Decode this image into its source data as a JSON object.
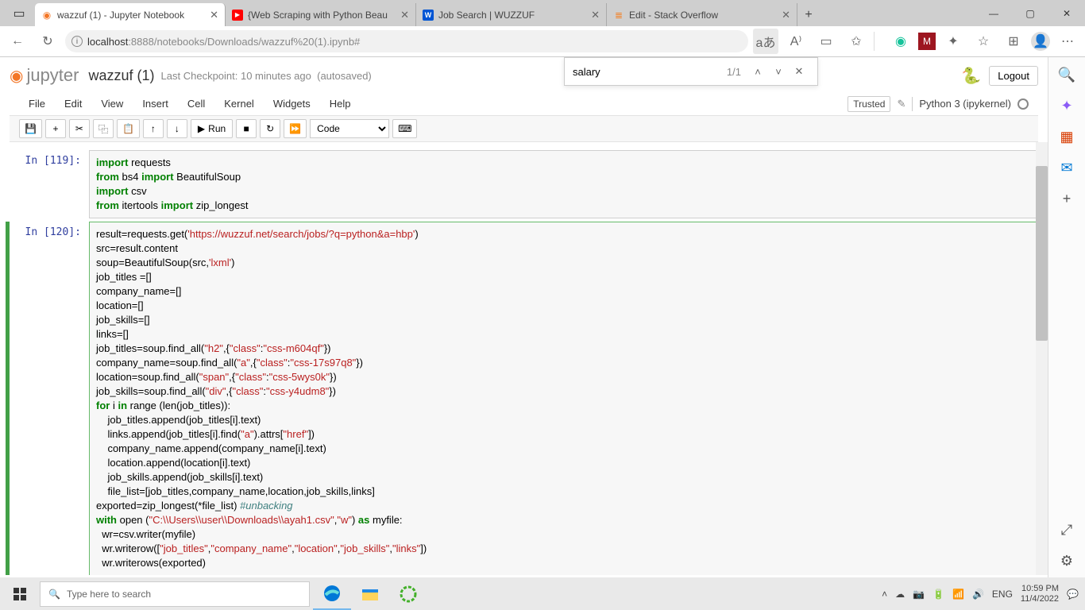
{
  "browser": {
    "tabs": [
      {
        "title": "wazzuf (1) - Jupyter Notebook",
        "active": true,
        "icon": "jupyter"
      },
      {
        "title": "{Web Scraping with Python Beau",
        "active": false,
        "icon": "youtube"
      },
      {
        "title": "Job Search | WUZZUF",
        "active": false,
        "icon": "wuzzuf"
      },
      {
        "title": "Edit - Stack Overflow",
        "active": false,
        "icon": "stackoverflow"
      }
    ],
    "url_host_prefix": "localhost",
    "url_path": ":8888/notebooks/Downloads/wazzuf%20(1).ipynb#"
  },
  "find": {
    "query": "salary",
    "count": "1/1"
  },
  "jupyter": {
    "logo_text": "jupyter",
    "title": "wazzuf (1)",
    "checkpoint": "Last Checkpoint: 10 minutes ago",
    "autosave": "(autosaved)",
    "logout": "Logout",
    "trusted": "Trusted",
    "kernel": "Python 3 (ipykernel)",
    "menus": [
      "File",
      "Edit",
      "View",
      "Insert",
      "Cell",
      "Kernel",
      "Widgets",
      "Help"
    ],
    "run_label": "Run",
    "cell_type": "Code"
  },
  "cells": {
    "c1_prompt": "In [119]:",
    "c2_prompt": "In [120]:",
    "c1_l1a": "import",
    "c1_l1b": " requests",
    "c1_l2a": "from",
    "c1_l2b": " bs4 ",
    "c1_l2c": "import",
    "c1_l2d": " BeautifulSoup",
    "c1_l3a": "import",
    "c1_l3b": " csv",
    "c1_l4a": "from",
    "c1_l4b": " itertools ",
    "c1_l4c": "import",
    "c1_l4d": " zip_longest",
    "c2_l1a": "result=requests.get(",
    "c2_l1b": "'https://wuzzuf.net/search/jobs/?q=python&a=hbp'",
    "c2_l1c": ")",
    "c2_l2": "src=result.content",
    "c2_l3a": "soup=BeautifulSoup(src,",
    "c2_l3b": "'lxml'",
    "c2_l3c": ")",
    "c2_l4": "job_titles =[]",
    "c2_l5": "company_name=[]",
    "c2_l6": "location=[]",
    "c2_l7": "job_skills=[]",
    "c2_l8": "links=[]",
    "c2_l9a": "job_titles=soup.find_all(",
    "c2_l9b": "\"h2\"",
    "c2_l9c": ",{",
    "c2_l9d": "\"class\"",
    "c2_l9e": ":",
    "c2_l9f": "\"css-m604qf\"",
    "c2_l9g": "})",
    "c2_l10a": "company_name=soup.find_all(",
    "c2_l10b": "\"a\"",
    "c2_l10c": ",{",
    "c2_l10d": "\"class\"",
    "c2_l10e": ":",
    "c2_l10f": "\"css-17s97q8\"",
    "c2_l10g": "})",
    "c2_l11a": "location=soup.find_all(",
    "c2_l11b": "\"span\"",
    "c2_l11c": ",{",
    "c2_l11d": "\"class\"",
    "c2_l11e": ":",
    "c2_l11f": "\"css-5wys0k\"",
    "c2_l11g": "})",
    "c2_l12a": "job_skills=soup.find_all(",
    "c2_l12b": "\"div\"",
    "c2_l12c": ",{",
    "c2_l12d": "\"class\"",
    "c2_l12e": ":",
    "c2_l12f": "\"css-y4udm8\"",
    "c2_l12g": "})",
    "c2_l13a": "for",
    "c2_l13b": " i ",
    "c2_l13c": "in",
    "c2_l13d": " range (len(job_titles)):",
    "c2_l14": "    job_titles.append(job_titles[i].text)",
    "c2_l15a": "    links.append(job_titles[i].find(",
    "c2_l15b": "\"a\"",
    "c2_l15c": ").attrs[",
    "c2_l15d": "\"href\"",
    "c2_l15e": "])",
    "c2_l16": "    company_name.append(company_name[i].text)",
    "c2_l17": "    location.append(location[i].text)",
    "c2_l18": "    job_skills.append(job_skills[i].text)",
    "c2_l19": "    file_list=[job_titles,company_name,location,job_skills,links]",
    "c2_l20a": "exported=zip_longest(*file_list) ",
    "c2_l20b": "#unbacking",
    "c2_l21a": "with",
    "c2_l21b": " open (",
    "c2_l21c": "\"C:\\\\Users\\\\user\\\\Downloads\\\\ayah1.csv\"",
    "c2_l21d": ",",
    "c2_l21e": "\"w\"",
    "c2_l21f": ") ",
    "c2_l21g": "as",
    "c2_l21h": " myfile:",
    "c2_l22": "  wr=csv.writer(myfile)",
    "c2_l23a": "  wr.writerow([",
    "c2_l23b": "\"job_titles\"",
    "c2_l23c": ",",
    "c2_l23d": "\"company_name\"",
    "c2_l23e": ",",
    "c2_l23f": "\"location\"",
    "c2_l23g": ",",
    "c2_l23h": "\"job_skills\"",
    "c2_l23i": ",",
    "c2_l23j": "\"links\"",
    "c2_l23k": "])",
    "c2_l24": "  wr.writerows(exported)"
  },
  "taskbar": {
    "search_placeholder": "Type here to search",
    "lang": "ENG",
    "time": "10:59 PM",
    "date": "11/4/2022"
  }
}
